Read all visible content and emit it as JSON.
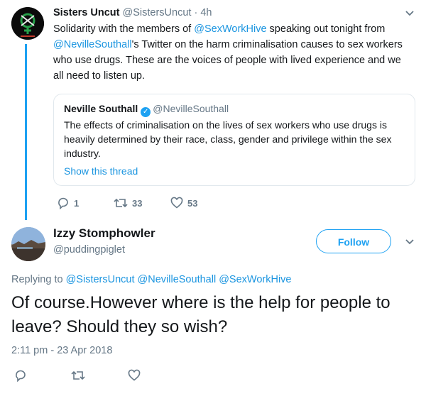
{
  "parent_tweet": {
    "author_name": "Sisters Uncut",
    "author_handle": "@SistersUncut",
    "separator": " · ",
    "time": "4h",
    "avatar_icon": "sisters-uncut-logo",
    "text_parts": [
      "Solidarity with the members of ",
      "@SexWorkHive",
      " speaking out tonight from ",
      "@NevilleSouthall",
      "'s Twitter on the harm criminalisation causes to sex workers who use drugs. These are the voices of people with lived experience and we all need to listen up."
    ],
    "quote": {
      "author_name": "Neville Southall",
      "author_handle": "@NevilleSouthall",
      "text": "The effects of criminalisation on the lives of sex workers who use drugs is heavily determined by their race, class, gender and privilege within the sex industry.",
      "show_thread": "Show this thread"
    },
    "counts": {
      "replies": "1",
      "retweets": "33",
      "likes": "53"
    }
  },
  "reply_tweet": {
    "author_name": "Izzy Stomphowler",
    "author_handle": "@puddingpiglet",
    "follow_label": "Follow",
    "replying_prefix": "Replying to ",
    "replying_to": [
      "@SistersUncut",
      "@NevilleSouthall",
      "@SexWorkHive"
    ],
    "text": "Of course.However where is the help for people to leave? Should they so wish?",
    "timestamp": "2:11 pm - 23 Apr 2018"
  },
  "colors": {
    "accent": "#1da1f2",
    "link": "#1b95e0",
    "muted": "#657786",
    "text": "#14171a",
    "border": "#e1e8ed"
  },
  "icons": [
    "reply-icon",
    "retweet-icon",
    "like-icon",
    "chevron-down-icon",
    "verified-icon"
  ]
}
